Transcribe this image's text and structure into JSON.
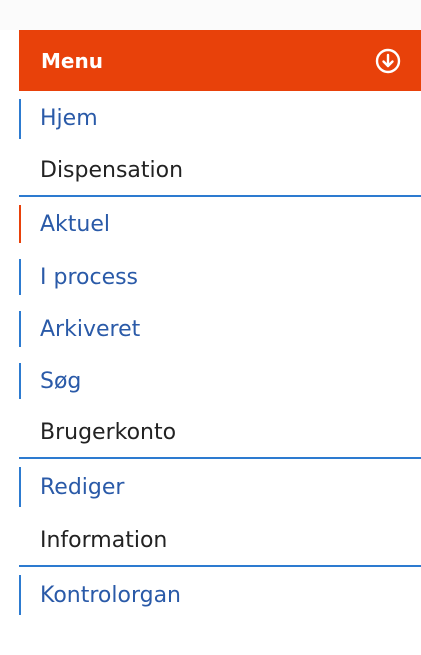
{
  "menu": {
    "title": "Menu",
    "toggle_icon": "arrow-down-circle-icon",
    "colors": {
      "header_bg": "#e8410a",
      "link": "#2a5aa8",
      "accent": "#2d7bd0",
      "active": "#e8410a"
    }
  },
  "items": {
    "home": "Hjem",
    "dispensation_heading": "Dispensation",
    "current": "Aktuel",
    "in_process": "I process",
    "archived": "Arkiveret",
    "search": "Søg",
    "account_heading": "Brugerkonto",
    "edit": "Rediger",
    "information_heading": "Information",
    "control_body": "Kontrolorgan"
  }
}
